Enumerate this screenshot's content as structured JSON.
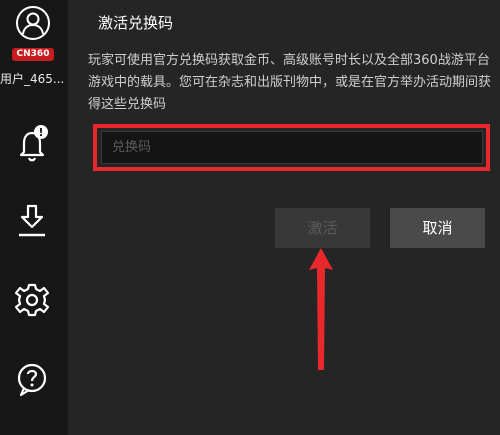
{
  "sidebar": {
    "avatar_icon": "user-avatar-icon",
    "region_badge": "CN360",
    "username": "用户_465...",
    "icons": [
      "bell-notification-icon",
      "download-icon",
      "gear-icon",
      "help-icon"
    ],
    "notification_indicator": "!"
  },
  "dialog": {
    "title": "激活兑换码",
    "description": "玩家可使用官方兑换码获取金币、高级账号时长以及全部360战游平台游戏中的载具。您可在杂志和出版刊物中，或是在官方举办活动期间获得这些兑换码",
    "code_input": {
      "value": "",
      "placeholder": "兑换码"
    },
    "activate_label": "激活",
    "cancel_label": "取消"
  },
  "colors": {
    "sidebar_bg": "#171717",
    "dialog_bg": "#252525",
    "highlight": "#e8282b",
    "badge": "#c81d1f"
  }
}
